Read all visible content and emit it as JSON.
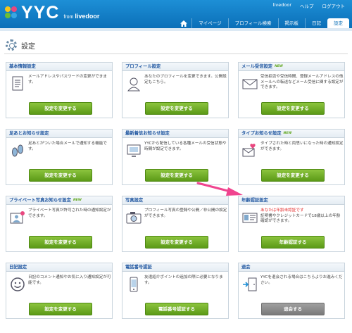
{
  "header": {
    "logo_text": "YYC",
    "logo_from": "from",
    "logo_brand": "livedoor",
    "top_links": [
      "livedoor",
      "ヘルプ",
      "ログアウト"
    ],
    "nav": [
      {
        "label": "",
        "icon": "home-icon"
      },
      {
        "label": "マイページ"
      },
      {
        "label": "プロフィール検索"
      },
      {
        "label": "掲示板"
      },
      {
        "label": "日記"
      },
      {
        "label": "設定",
        "active": true
      }
    ]
  },
  "page": {
    "title": "設定"
  },
  "cards": [
    {
      "title": "基本情報設定",
      "icon": "document-icon",
      "desc": "メールアドレスやパスワードの変更ができます。",
      "button": "設定を変更する"
    },
    {
      "title": "プロフィール設定",
      "icon": "profile-person-icon",
      "desc": "あなたのプロフィールを変更できます。公開設定もこちら。",
      "button": "設定を変更する"
    },
    {
      "title": "メール受信設定",
      "new": "NEW",
      "icon": "envelope-icon",
      "desc": "受信拒否や受信時間、登録メールアドレスの他メールへの転送などメール受信に関する設定ができます。",
      "button": "設定を変更する"
    },
    {
      "title": "足あとお知らせ設定",
      "icon": "footprints-icon",
      "desc": "足あとがついた場合メールで通知する機能です。",
      "button": "設定を変更する"
    },
    {
      "title": "最新着信お知らせ設定",
      "icon": "monitor-icon",
      "desc": "YYCから配信している各種メールの受信状態や時間が設定できます。",
      "button": "設定を変更する"
    },
    {
      "title": "タイプお知らせ設定",
      "new": "NEW",
      "icon": "heart-mail-icon",
      "desc": "タイプされた時と両思いになった時の通知設定ができます。",
      "button": "設定を変更する"
    },
    {
      "title": "プライベート写真お知らせ設定",
      "new": "NEW",
      "icon": "photo-person-icon",
      "desc": "プライベート写真が許可された時の通知設定ができます。",
      "button": "設定を変更する"
    },
    {
      "title": "写真設定",
      "icon": "camera-icon",
      "desc": "プロフィール写真の登録や公開／非公開の設定ができます。",
      "button": "設定を変更する"
    },
    {
      "title": "年齢認証設定",
      "icon": "id-card-icon",
      "desc": "あなたは年齢未認証です",
      "desc2": "証明書やクレジットカードで18歳以上の年齢確認ができます。",
      "button": "年齢認証する"
    },
    {
      "title": "日記設定",
      "icon": "smiley-icon",
      "desc": "日記のコメント通知やお気に入り通知設定が可能です。",
      "button": "設定を変更する"
    },
    {
      "title": "電話番号認証",
      "icon": "phone-icon",
      "desc": "友達紹介ポイントの追加の際に必要となります。",
      "button": "電話番号認証する"
    },
    {
      "title": "退会",
      "icon": "exit-door-icon",
      "desc": "YYCを退会される場合はこちらよりお進みください。",
      "button": "退会する",
      "button_style": "gray"
    }
  ],
  "colors": {
    "header_blue": "#0b6fb8",
    "title_blue": "#1e55a0",
    "button_green": "#6aa823",
    "arrow_pink": "#f0448f",
    "warning_red": "#e32828"
  }
}
